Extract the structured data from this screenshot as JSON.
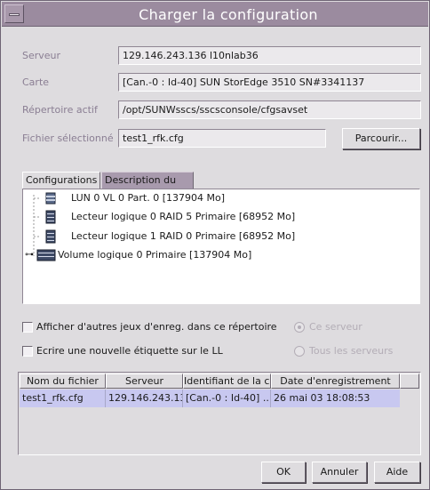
{
  "window": {
    "title": "Charger la configuration"
  },
  "form": {
    "server_label": "Serveur",
    "server_value": "129.146.243.136 l10nlab36",
    "card_label": "Carte",
    "card_value": "[Can.-0 : Id-40] SUN StorEdge 3510 SN#3341137",
    "dir_label": "Répertoire actif",
    "dir_value": "/opt/SUNWsscs/sscsconsole/cfgsavset",
    "file_label": "Fichier sélectionné",
    "file_value": "test1_rfk.cfg",
    "browse_label": "Parcourir..."
  },
  "tabs": [
    {
      "label": "Configurations"
    },
    {
      "label": "Description du jeu"
    }
  ],
  "tree": [
    "LUN 0 VL 0 Part. 0 [137904 Mo]",
    "Lecteur logique 0 RAID 5 Primaire [68952 Mo]",
    "Lecteur logique 1 RAID 0 Primaire [68952 Mo]",
    "Volume logique 0 Primaire [137904 Mo]"
  ],
  "options": {
    "other_sets_label": "Afficher d'autres jeux d'enreg. dans ce répertoire",
    "new_label_label": "Ecrire une nouvelle étiquette sur le LL",
    "this_server_label": "Ce serveur",
    "all_servers_label": "Tous les serveurs"
  },
  "table": {
    "columns": [
      "Nom du fichier",
      "Serveur",
      "Identifiant de la c...",
      "Date d'enregistrement"
    ],
    "rows": [
      [
        "test1_rfk.cfg",
        "129.146.243.13...",
        "[Can.-0 : Id-40] ...",
        "26 mai 03 18:08:53"
      ]
    ]
  },
  "buttons": {
    "ok": "OK",
    "cancel": "Annuler",
    "help": "Aide"
  },
  "colors": {
    "titlebar": "#9b8b9f",
    "selection": "#c8c8f0",
    "label_text": "#8a7e93"
  }
}
